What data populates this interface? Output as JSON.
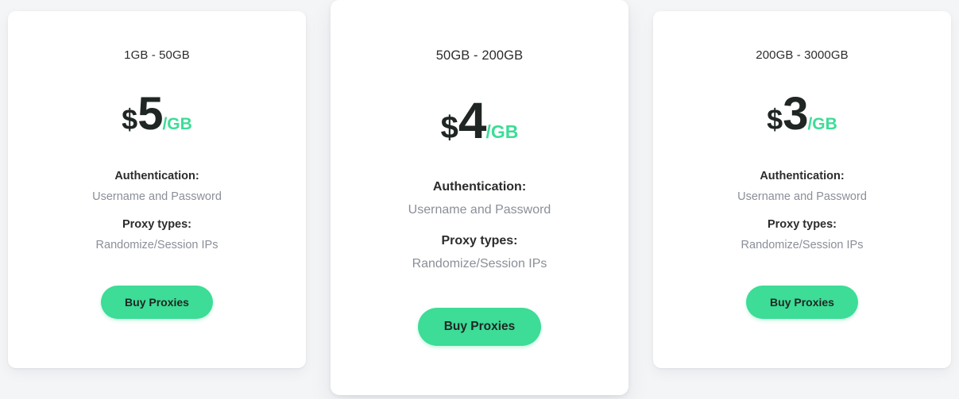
{
  "theme": {
    "page_background": "#F4F5F7",
    "card_background": "#FFFFFF",
    "accent_green": "#3DDC97",
    "text_dark": "#2C2C2C",
    "text_muted": "#8A8F98",
    "price_color": "#1F2623"
  },
  "plans": [
    {
      "id": "starter",
      "featured": false,
      "title": "1GB - 50GB",
      "price": {
        "currency": "$",
        "amount": "5",
        "unit": "/GB"
      },
      "features": [
        {
          "label": "Authentication:",
          "value": "Username and Password"
        },
        {
          "label": "Proxy types:",
          "value": "Randomize/Session IPs"
        }
      ],
      "cta_label": "Buy Proxies"
    },
    {
      "id": "standard",
      "featured": true,
      "title": "50GB - 200GB",
      "price": {
        "currency": "$",
        "amount": "4",
        "unit": "/GB"
      },
      "features": [
        {
          "label": "Authentication:",
          "value": "Username and Password"
        },
        {
          "label": "Proxy types:",
          "value": "Randomize/Session IPs"
        }
      ],
      "cta_label": "Buy Proxies"
    },
    {
      "id": "enterprise",
      "featured": false,
      "title": "200GB - 3000GB",
      "price": {
        "currency": "$",
        "amount": "3",
        "unit": "/GB"
      },
      "features": [
        {
          "label": "Authentication:",
          "value": "Username and Password"
        },
        {
          "label": "Proxy types:",
          "value": "Randomize/Session IPs"
        }
      ],
      "cta_label": "Buy Proxies"
    }
  ]
}
